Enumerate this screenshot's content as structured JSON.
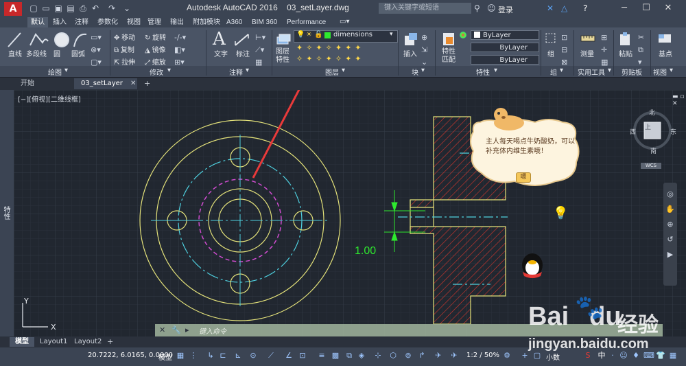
{
  "app": {
    "title": "Autodesk AutoCAD 2016",
    "file": "03_setLayer.dwg",
    "logo": "A"
  },
  "search": {
    "placeholder": "键入关键字或短语"
  },
  "user": {
    "login": "登录"
  },
  "ribbon_tabs": [
    "默认",
    "插入",
    "注释",
    "参数化",
    "视图",
    "管理",
    "输出",
    "附加模块",
    "A360",
    "BIM 360",
    "Performance"
  ],
  "ribbon": {
    "draw": {
      "line": "直线",
      "polyline": "多段线",
      "circle": "圆",
      "arc": "圆弧",
      "panel": "绘图"
    },
    "modify": {
      "move": "移动",
      "rotate": "旋转",
      "copy": "复制",
      "mirror": "镜像",
      "stretch": "拉伸",
      "scale": "缩放",
      "panel": "修改"
    },
    "annotation": {
      "text": "文字",
      "dimension": "标注",
      "panel": "注释"
    },
    "layers": {
      "layer_props_1": "图层",
      "layer_props_2": "特性",
      "current_layer": "dimensions",
      "panel": "图层"
    },
    "block": {
      "insert": "插入",
      "panel": "块"
    },
    "properties": {
      "match_1": "特性",
      "match_2": "匹配",
      "color": "ByLayer",
      "linetype": "ByLayer",
      "lineweight": "ByLayer",
      "panel": "特性"
    },
    "groups": {
      "group": "组",
      "panel": "组"
    },
    "utilities": {
      "measure": "测量",
      "panel": "实用工具"
    },
    "clipboard": {
      "paste": "粘贴",
      "panel": "剪贴板"
    },
    "view": {
      "basepoint": "基点",
      "panel": "视图"
    }
  },
  "doc_tabs": [
    "开始",
    "03_setLayer"
  ],
  "viewport_label": "[−][俯视][二维线框]",
  "side_palette": "特性",
  "viewcube": {
    "north": "北",
    "south": "南",
    "east": "东",
    "west": "西",
    "top": "上",
    "wcs": "WCS"
  },
  "ucs": {
    "x": "X",
    "y": "Y"
  },
  "dimension_value": "1.00",
  "command_placeholder": "键入命令",
  "layout_tabs": [
    "模型",
    "Layout1",
    "Layout2"
  ],
  "status": {
    "coords": "20.7222, 6.0165, 0.0000",
    "model": "模型",
    "scale": "1:2 / 50%",
    "units": "小数"
  },
  "popup": {
    "message": "主人每天喝点牛奶酸奶，可以补充体内维生素哦！",
    "button": "嗯"
  },
  "watermark": {
    "brand": "Bai",
    "brand2": "du",
    "jingyan": "经验",
    "url": "jingyan.baidu.com"
  },
  "colors": {
    "title_bg": "#3b4453",
    "ribbon_bg": "#4a5465",
    "canvas_bg": "#212730",
    "layer_green": "#2ee82e",
    "arrow": "#e83a3a"
  }
}
